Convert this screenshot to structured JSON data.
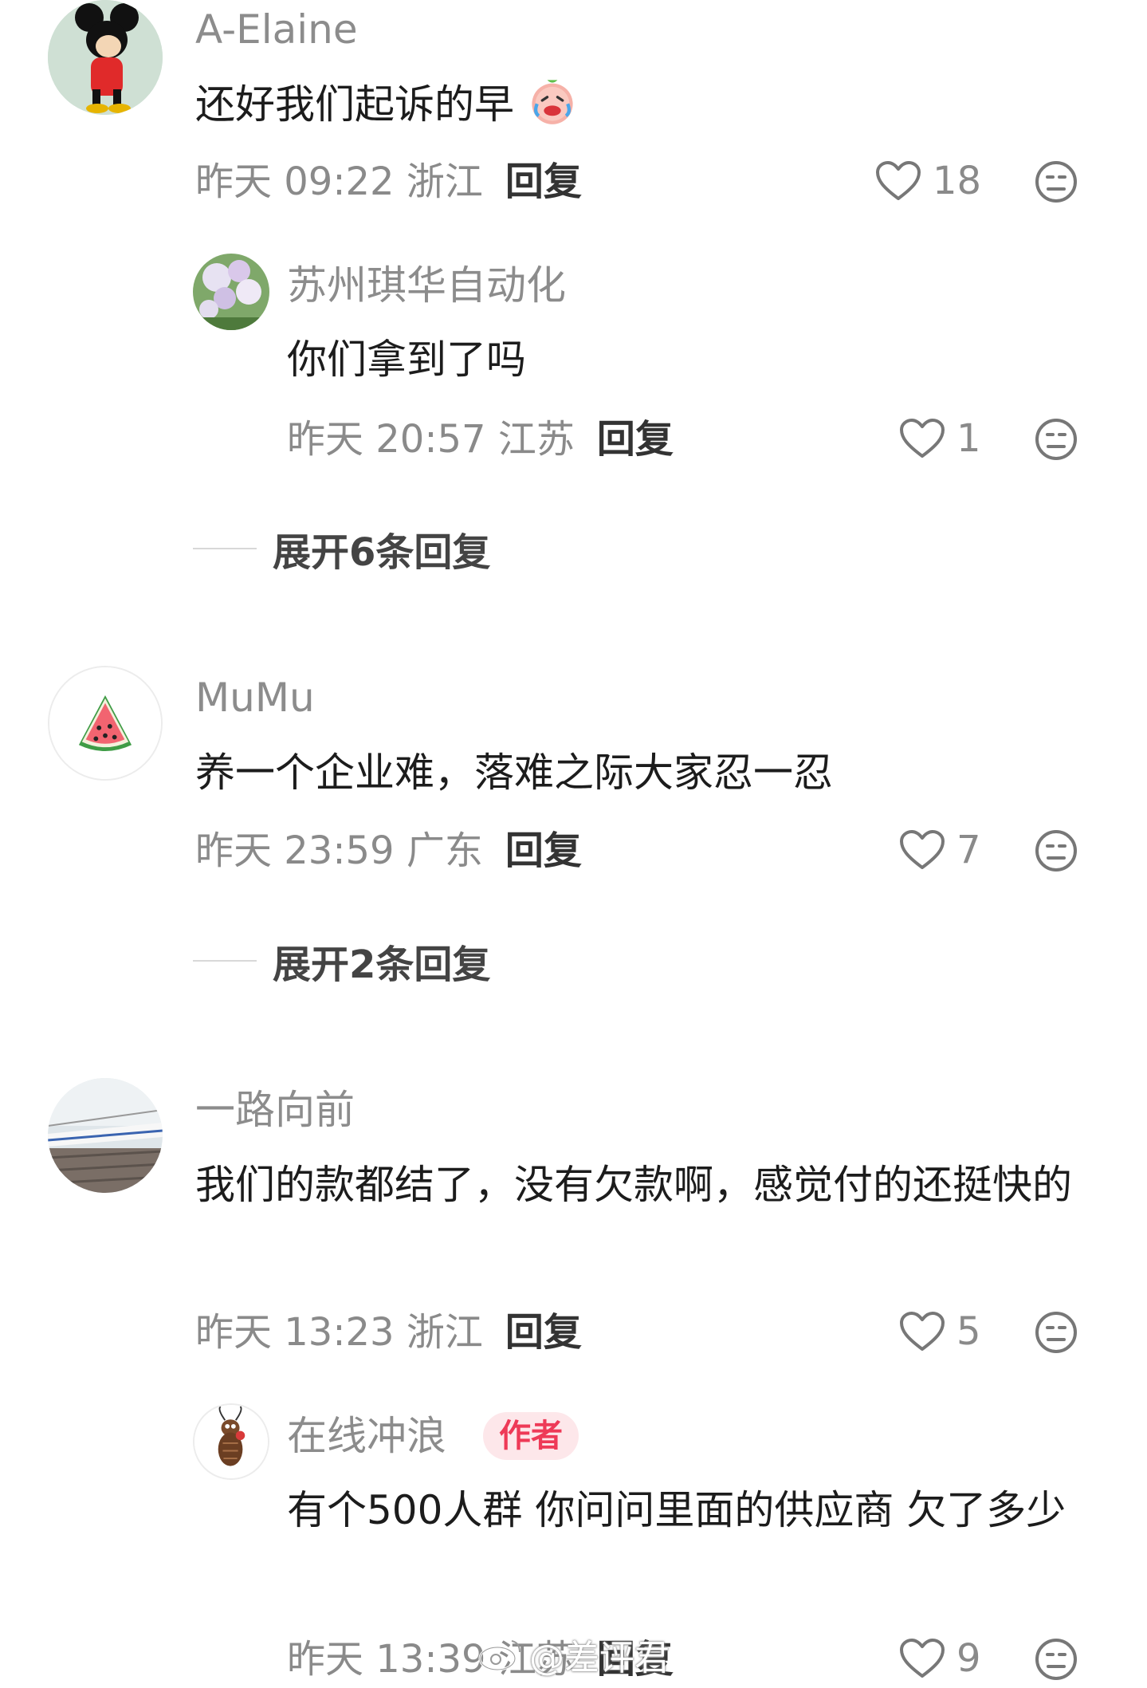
{
  "comments": [
    {
      "username": "A-Elaine",
      "text": "还好我们起诉的早",
      "time_location": "昨天 09:22 浙江",
      "reply_label": "回复",
      "likes": "18",
      "replies": [
        {
          "username": "苏州琪华自动化",
          "text": "你们拿到了吗",
          "time_location": "昨天 20:57 江苏",
          "reply_label": "回复",
          "likes": "1"
        }
      ],
      "expand_label": "展开6条回复"
    },
    {
      "username": "MuMu",
      "text": "养一个企业难，落难之际大家忍一忍",
      "time_location": "昨天 23:59 广东",
      "reply_label": "回复",
      "likes": "7",
      "expand_label": "展开2条回复"
    },
    {
      "username": "一路向前",
      "text": "我们的款都结了，没有欠款啊，感觉付的还挺快的",
      "time_location": "昨天 13:23 浙江",
      "reply_label": "回复",
      "likes": "5",
      "replies": [
        {
          "username": "在线冲浪",
          "badge": "作者",
          "text": "有个500人群 你问问里面的供应商 欠了多少",
          "time_location": "昨天 13:39 江苏",
          "reply_label": "回复",
          "likes": "9"
        }
      ]
    }
  ],
  "watermark": "@差评君",
  "colors": {
    "badge_bg": "#fde7ea",
    "badge_text": "#ee3a57",
    "meta_text": "#8a8a8a",
    "name_text": "#8c8c8c"
  },
  "icons": [
    "heart-outline-icon",
    "dislike-face-icon",
    "crying-laugh-emoji"
  ]
}
